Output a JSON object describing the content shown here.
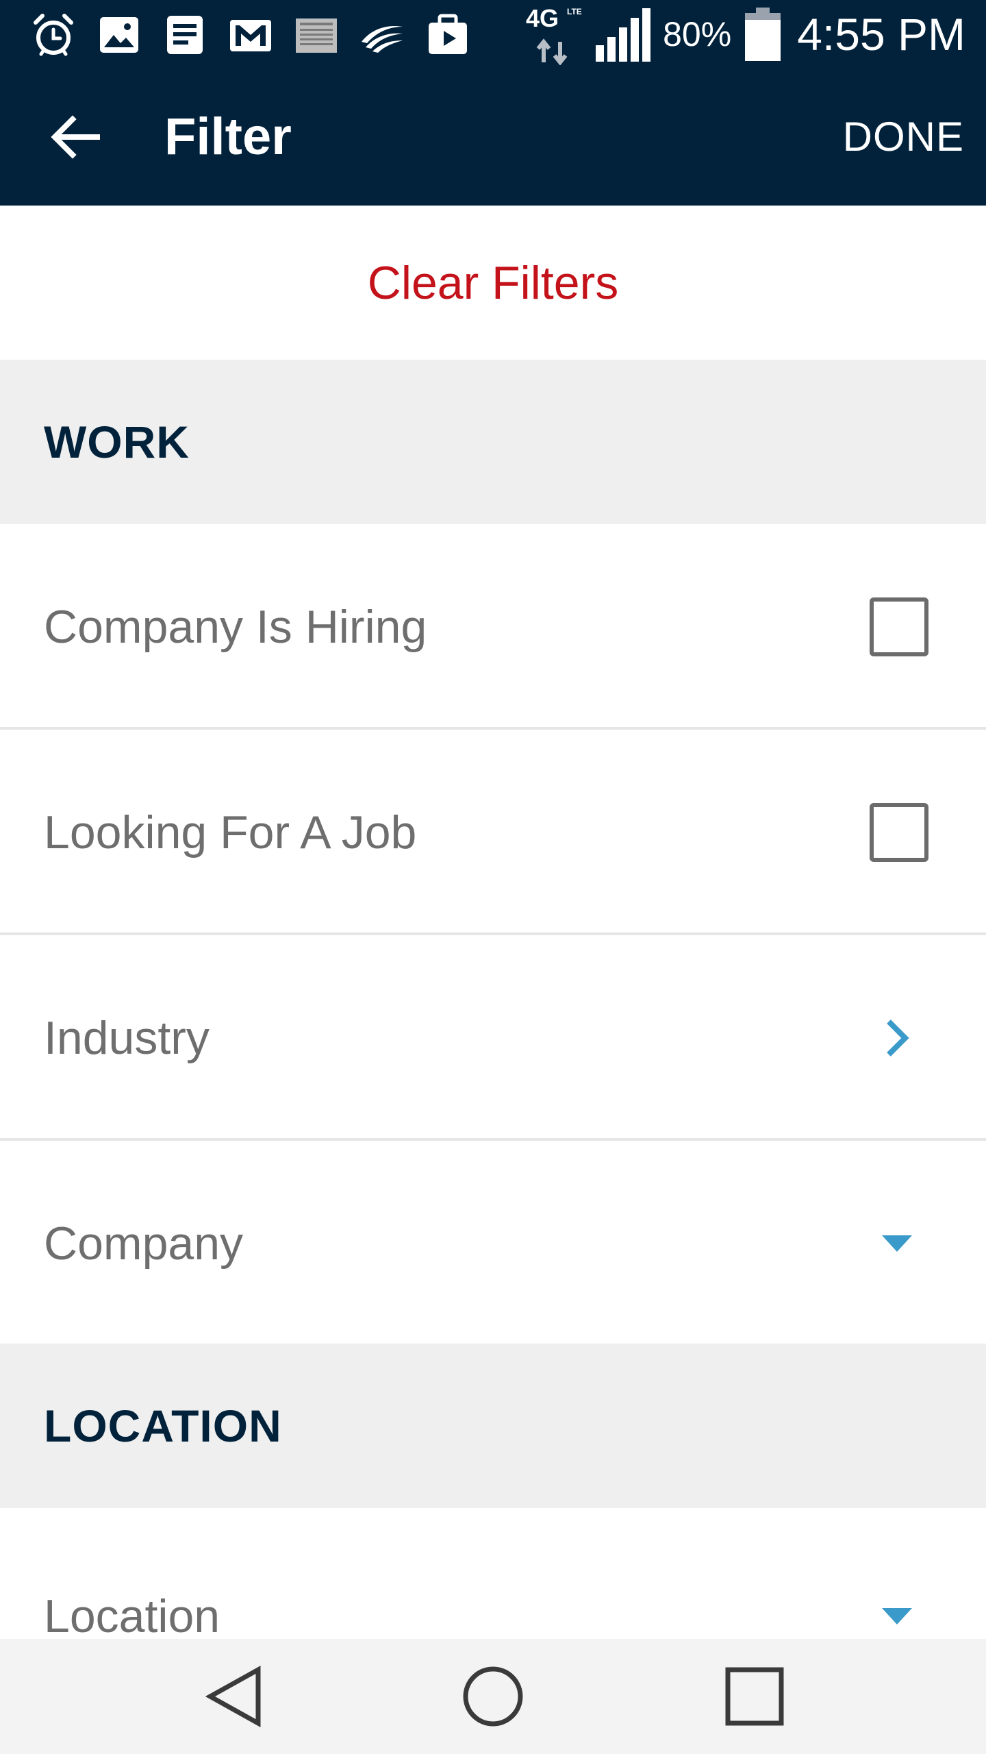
{
  "status_bar": {
    "left_icons": [
      "alarm-clock-icon",
      "gallery-icon",
      "notes-icon",
      "gmail-icon",
      "newspaper-icon",
      "swiftkey-icon",
      "briefcase-icon"
    ],
    "network": "4G LTE",
    "battery_percent": "80%",
    "time": "4:55 PM"
  },
  "app_bar": {
    "back_icon": "arrow-left-icon",
    "title": "Filter",
    "done_label": "DONE",
    "background_color": "#02223b"
  },
  "actions": {
    "clear_filters_label": "Clear Filters",
    "clear_filters_color": "#c4121a"
  },
  "sections": {
    "work": {
      "title": "WORK",
      "rows": {
        "company_is_hiring": {
          "label": "Company Is Hiring",
          "control": "checkbox",
          "checked": false
        },
        "looking_for_a_job": {
          "label": "Looking For A Job",
          "control": "checkbox",
          "checked": false
        },
        "industry": {
          "label": "Industry",
          "control": "chevron-right-icon"
        },
        "company": {
          "label": "Company",
          "control": "dropdown-caret-icon"
        }
      }
    },
    "location": {
      "title": "LOCATION",
      "rows": {
        "location": {
          "label": "Location",
          "control": "dropdown-caret-icon"
        }
      }
    }
  },
  "accent_color": "#3a9ac9",
  "nav_bar": {
    "buttons": [
      "back-triangle-icon",
      "home-circle-icon",
      "recents-square-icon"
    ]
  }
}
